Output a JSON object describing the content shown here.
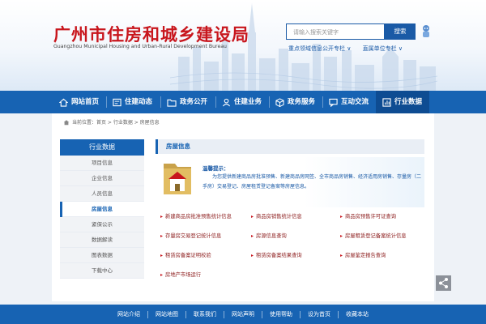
{
  "site": {
    "title": "广州市住房和城乡建设局",
    "subtitle": "Guangzhou Municipal Housing and Urban-Rural Development Bureau"
  },
  "search": {
    "placeholder": "请输入搜索关键字",
    "button_label": "搜索",
    "quick_links": [
      "重点领域信息公开专栏  ∨",
      "直属单位专栏  ∨"
    ]
  },
  "nav": {
    "items": [
      {
        "label": "网站首页",
        "icon": "home-icon"
      },
      {
        "label": "住建动态",
        "icon": "news-icon"
      },
      {
        "label": "政务公开",
        "icon": "folder-icon"
      },
      {
        "label": "住建业务",
        "icon": "user-icon"
      },
      {
        "label": "政务服务",
        "icon": "box-icon"
      },
      {
        "label": "互动交流",
        "icon": "chat-icon"
      },
      {
        "label": "行业数据",
        "icon": "chart-icon"
      }
    ]
  },
  "breadcrumb": "当前位置：首页 > 行业数据 > 房屋信息",
  "sidebar": {
    "heading": "行业数据",
    "items": [
      "项目信息",
      "企业信息",
      "人员信息",
      "房屋信息",
      "紧保公示",
      "数据解读",
      "图表数据",
      "下载中心"
    ]
  },
  "section": {
    "title": "房屋信息",
    "intro_title": "温馨提示：",
    "intro_text": "为您提供新建商品房批准预售、新建商品房网签、全市商品房销售、经济适用房销售、存量房（二手房）交易登记、房屋租赁登记备案等房屋信息。"
  },
  "links": [
    "新建商品房批准预售统计信息",
    "商品房销售统计信息",
    "商品房预售许可证查询",
    "存量房交易登记统计信息",
    "房源信息查询",
    "房屋租赁登记备案统计信息",
    "租赁房备案证明校验",
    "租赁房备案结果查询",
    "房屋鉴定报告查询",
    "房地产市场运行"
  ],
  "footer": {
    "links": [
      "网站介绍",
      "网站地图",
      "联系我们",
      "网站声明",
      "使用帮助",
      "设为首页",
      "收藏本站"
    ]
  },
  "colors": {
    "primary": "#1763b3",
    "title_red": "#c8161d",
    "link_red": "#8b1a1a"
  }
}
